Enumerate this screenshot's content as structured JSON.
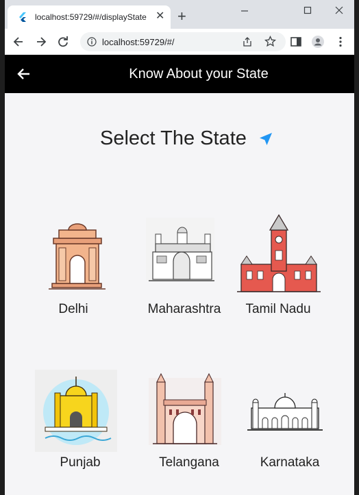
{
  "browser": {
    "tab_title": "localhost:59729/#/displayState",
    "close_tab": "✕",
    "new_tab": "+",
    "url": "localhost:59729/#/"
  },
  "appbar": {
    "title": "Know About your State"
  },
  "main": {
    "heading": "Select The State",
    "states": [
      {
        "name": "Delhi",
        "icon": "india-gate-icon"
      },
      {
        "name": "Maharashtra",
        "icon": "gateway-of-india-icon"
      },
      {
        "name": "Tamil Nadu",
        "icon": "chennai-central-icon"
      },
      {
        "name": "Punjab",
        "icon": "golden-temple-icon"
      },
      {
        "name": "Telangana",
        "icon": "charminar-icon"
      },
      {
        "name": "Karnataka",
        "icon": "mysore-palace-icon"
      }
    ]
  },
  "colors": {
    "appbar_bg": "#000000",
    "accent_blue": "#2196f3",
    "page_bg": "#f5f5f7"
  }
}
